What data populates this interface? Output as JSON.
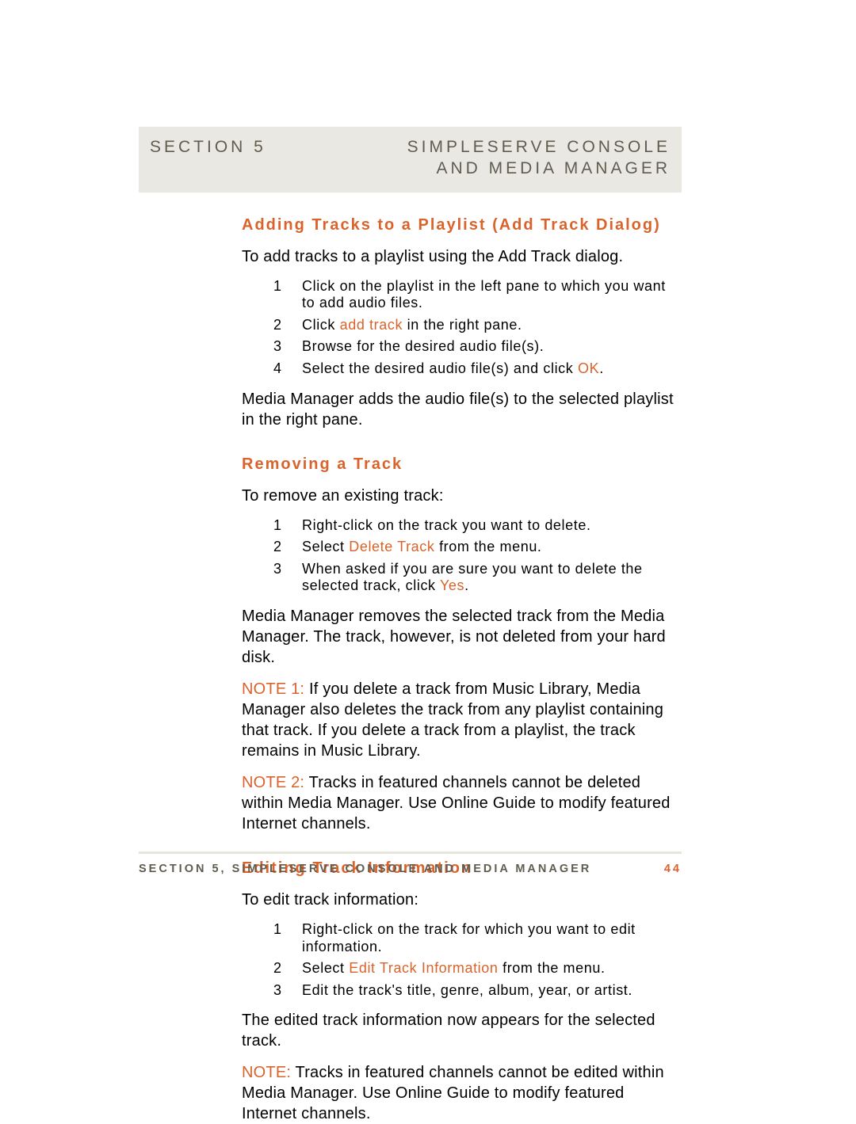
{
  "banner": {
    "left": "SECTION 5",
    "right1": "SIMPLESERVE CONSOLE",
    "right2": "AND MEDIA MANAGER"
  },
  "adding": {
    "heading": "Adding Tracks to a Playlist (Add Track Dialog)",
    "intro": "To add tracks to a playlist using the Add Track dialog.",
    "step1": "Click on the playlist in the left pane to which you want to add audio files.",
    "step2a": "Click ",
    "step2hl": "add track",
    "step2b": " in the right pane.",
    "step3": "Browse for the desired audio file(s).",
    "step4a": "Select the desired audio file(s) and click ",
    "step4hl": "OK",
    "step4b": ".",
    "outro": "Media Manager adds the audio file(s) to the selected playlist in the right pane."
  },
  "removing": {
    "heading": "Removing a Track",
    "intro": "To remove an existing track:",
    "step1": "Right-click on the track you want to delete.",
    "step2a": "Select ",
    "step2hl": "Delete Track",
    "step2b": " from the menu.",
    "step3a": "When asked if you are sure you want to delete the selected track, click ",
    "step3hl": "Yes",
    "step3b": ".",
    "outro": "Media Manager removes the selected track from the Media Manager.  The track, however, is not deleted from your hard disk.",
    "note1hl": "NOTE 1:",
    "note1": " If you delete a track from Music Library, Media Manager also deletes the track from any playlist containing that track.  If you delete a track from a playlist, the track remains in Music Library.",
    "note2hl": "NOTE 2:",
    "note2": " Tracks in featured channels cannot be deleted within Media Manager.  Use Online Guide to modify featured Internet channels."
  },
  "editing": {
    "heading": "Editing Track Information",
    "intro": "To edit track information:",
    "step1": "Right-click on the track for which you want to edit information.",
    "step2a": "Select ",
    "step2hl": "Edit Track Information",
    "step2b": " from the menu.",
    "step3": "Edit the track's title, genre, album, year, or artist.",
    "outro": "The edited track information now appears for the selected track.",
    "notehl": "NOTE:",
    "note": " Tracks in featured channels cannot be edited within Media Manager.  Use Online Guide to modify featured Internet channels."
  },
  "footer": {
    "text": "SECTION 5, SIMPLESERVE CONSOLE AND MEDIA MANAGER",
    "page": "44"
  }
}
